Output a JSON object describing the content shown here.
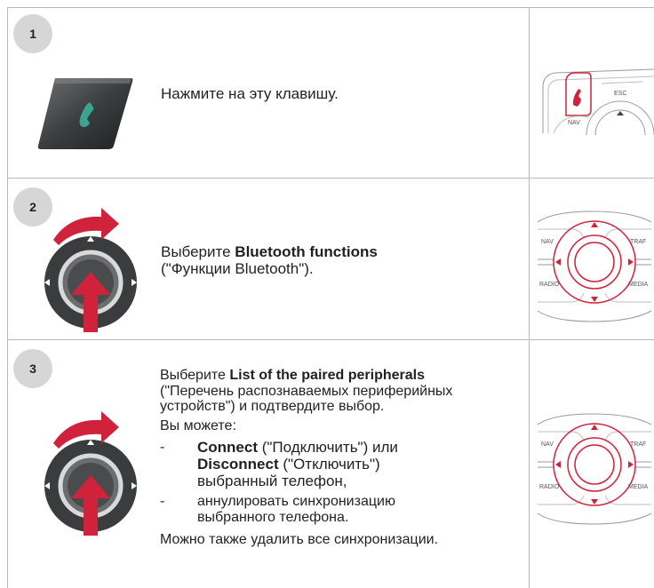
{
  "steps": [
    {
      "number": "1",
      "text": "Нажмите на эту клавишу."
    },
    {
      "number": "2",
      "pre": "Выберите ",
      "bold": "Bluetooth functions",
      "post": "(\"Функции Bluetooth\")."
    },
    {
      "number": "3",
      "line1_pre": "Выберите ",
      "line1_bold": "List of the paired peripherals",
      "line2": "(\"Перечень распознаваемых периферийных",
      "line3": "устройств\") и подтвердите выбор.",
      "line4": "Вы можете:",
      "bullet1_bold1": "Connect",
      "bullet1_text1": " (\"Подключить\") или",
      "bullet1_bold2": "Disconnect",
      "bullet1_text2": " (\"Отключить\")",
      "bullet1_text3": "выбранный телефон,",
      "bullet2_line1": "аннулировать синхронизацию",
      "bullet2_line2": "выбранного телефона.",
      "footer": "Можно также удалить все синхронизации.",
      "dash": "-"
    }
  ],
  "panel_labels": {
    "esc": "ESC",
    "nav": "NAV",
    "traf": "TRAF",
    "radio": "RADIO",
    "media": "MEDIA"
  },
  "colors": {
    "accent_red": "#d1223b",
    "phone_green": "#3aa58e"
  }
}
